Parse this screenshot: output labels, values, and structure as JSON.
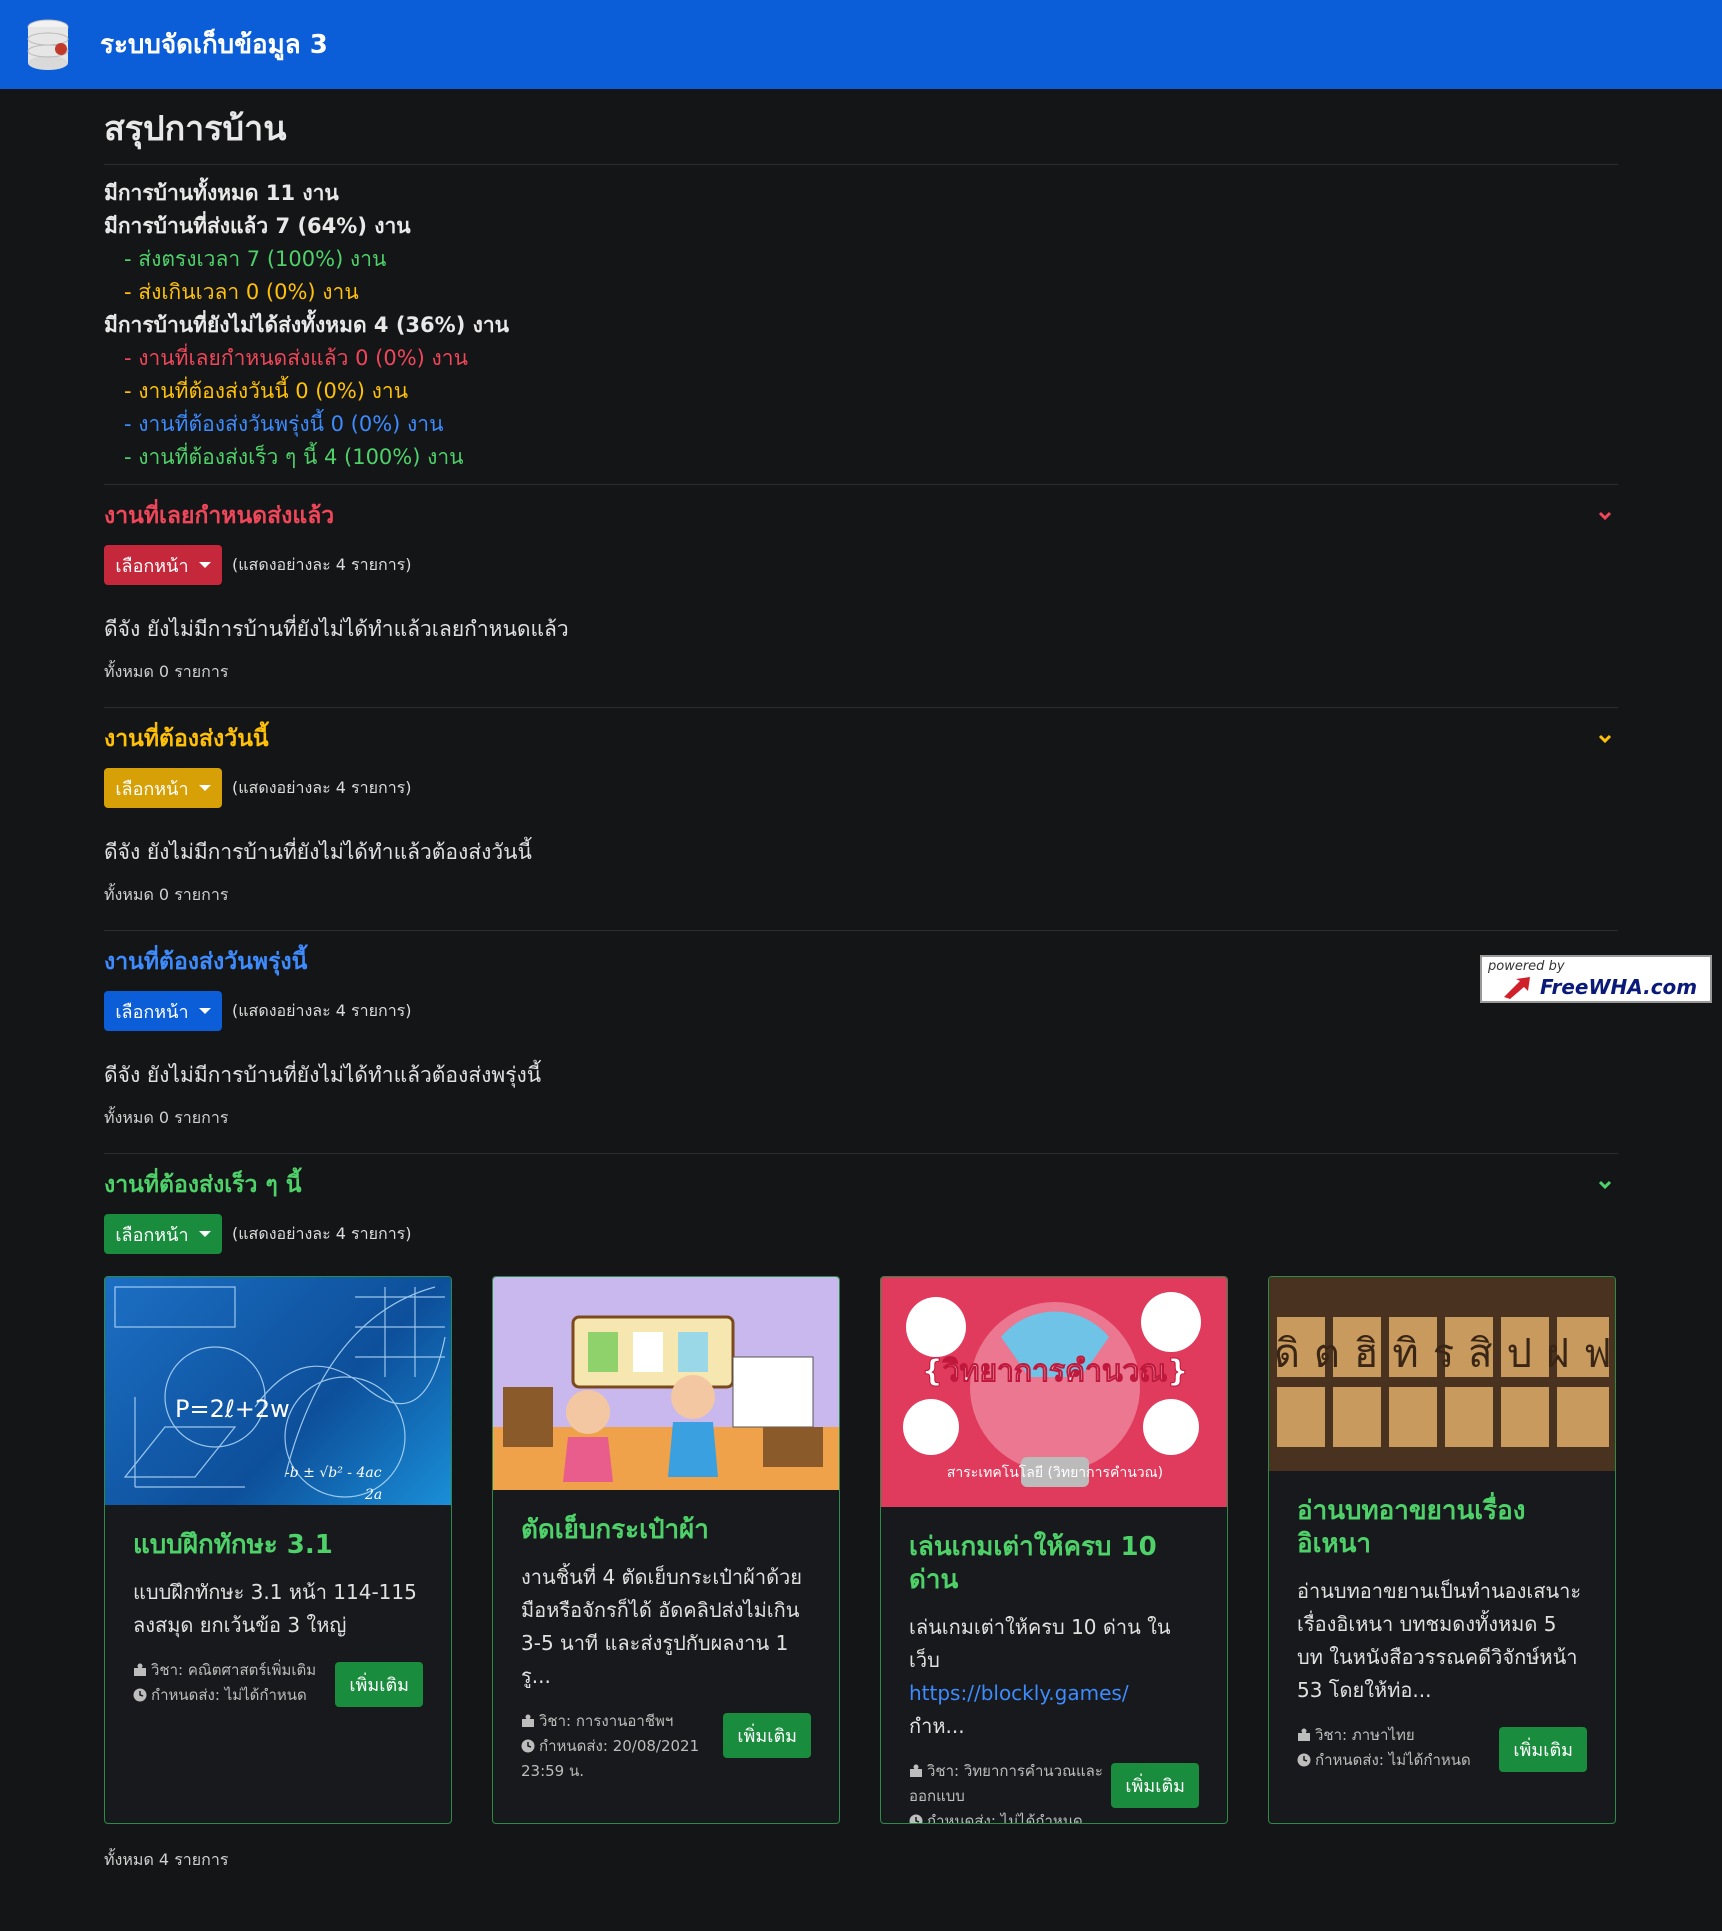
{
  "app": {
    "title": "ระบบจัดเก็บข้อมูล 3",
    "logo_icon": "database-icon"
  },
  "page": {
    "title": "สรุปการบ้าน"
  },
  "summary": {
    "total": "มีการบ้านทั้งหมด 11 งาน",
    "submitted": "มีการบ้านที่ส่งแล้ว 7 (64%) งาน",
    "on_time": "- ส่งตรงเวลา 7 (100%) งาน",
    "late": "- ส่งเกินเวลา 0 (0%) งาน",
    "not_submitted": "มีการบ้านที่ยังไม่ได้ส่งทั้งหมด 4 (36%) งาน",
    "overdue": "- งานที่เลยกำหนดส่งแล้ว 0 (0%) งาน",
    "due_today": "- งานที่ต้องส่งวันนี้ 0 (0%) งาน",
    "due_tomorrow": "- งานที่ต้องส่งวันพรุ่งนี้ 0 (0%) งาน",
    "due_soon": "- งานที่ต้องส่งเร็ว ๆ นี้ 4 (100%) งาน"
  },
  "sections": {
    "overdue": {
      "title": "งานที่เลยกำหนดส่งแล้ว",
      "pick_label": "เลือกหน้า",
      "note": "(แสดงอย่างละ 4 รายการ)",
      "empty": "ดีจัง ยังไม่มีการบ้านที่ยังไม่ได้ทำแล้วเลยกำหนดแล้ว",
      "count": "ทั้งหมด 0 รายการ",
      "color": "#f0465a"
    },
    "today": {
      "title": "งานที่ต้องส่งวันนี้",
      "pick_label": "เลือกหน้า",
      "note": "(แสดงอย่างละ 4 รายการ)",
      "empty": "ดีจัง ยังไม่มีการบ้านที่ยังไม่ได้ทำแล้วต้องส่งวันนี้",
      "count": "ทั้งหมด 0 รายการ",
      "color": "#ffc107"
    },
    "tomorrow": {
      "title": "งานที่ต้องส่งวันพรุ่งนี้",
      "pick_label": "เลือกหน้า",
      "note": "(แสดงอย่างละ 4 รายการ)",
      "empty": "ดีจัง ยังไม่มีการบ้านที่ยังไม่ได้ทำแล้วต้องส่งพรุ่งนี้",
      "count": "ทั้งหมด 0 รายการ",
      "color": "#3d8bfd"
    },
    "soon": {
      "title": "งานที่ต้องส่งเร็ว ๆ นี้",
      "pick_label": "เลือกหน้า",
      "note": "(แสดงอย่างละ 4 รายการ)",
      "count": "ทั้งหมด 4 รายการ",
      "color": "#4fd16a"
    }
  },
  "cards": [
    {
      "title": "แบบฝึกทักษะ 3.1",
      "text": "แบบฝึกทักษะ 3.1 หน้า 114-115 ลงสมุด ยกเว้นข้อ 3 ใหญ่",
      "subject": "วิชา: คณิตศาสตร์เพิ่มเติม",
      "due": "กำหนดส่ง: ไม่ได้กำหนด",
      "more": "เพิ่มเติม",
      "image_formula": "P=2ℓ+2w",
      "image_formula2": "-b ± √b² - 4ac",
      "image_formula3": "2a"
    },
    {
      "title": "ตัดเย็บกระเป๋าผ้า",
      "text": "งานชิ้นที่ 4 ตัดเย็บกระเป๋าผ้าด้วยมือหรือจักรก็ได้ อัดคลิปส่งไม่เกิน 3-5 นาที และส่งรูปกับผลงาน 1 รู...",
      "subject": "วิชา: การงานอาชีพฯ",
      "due": "กำหนดส่ง: 20/08/2021 23:59 น.",
      "more": "เพิ่มเติม"
    },
    {
      "title": "เล่นเกมเต่าให้ครบ 10 ด่าน",
      "text_before": "เล่นเกมเต่าให้ครบ 10 ด่าน ในเว็บ",
      "link": "https://blockly.games/",
      "text_after": "กำห...",
      "subject": "วิชา: วิทยาการคำนวณและออกแบบ",
      "due": "กำหนดส่ง: ไม่ได้กำหนด",
      "more": "เพิ่มเติม",
      "image_title": "{วิทยาการคำนวณ}",
      "image_caption": "สาระเทคโนโลยี (วิทยาการคำนวณ)"
    },
    {
      "title": "อ่านบทอาขยานเรื่องอิเหนา",
      "text": "อ่านบทอาขยานเป็นทำนองเสนาะ เรื่องอิเหนา บทชมดงทั้งหมด 5 บท ในหนังสือวรรณคดีวิจักษ์หน้า 53 โดยให้ท่อ...",
      "subject": "วิชา: ภาษาไทย",
      "due": "กำหนดส่ง: ไม่ได้กำหนด",
      "more": "เพิ่มเติม",
      "image_letters": "ฒิฌดิตฮิทิรสิปฝฟฑย"
    }
  ],
  "powered": {
    "line1": "powered by",
    "line2": "FreeWHA.com"
  }
}
